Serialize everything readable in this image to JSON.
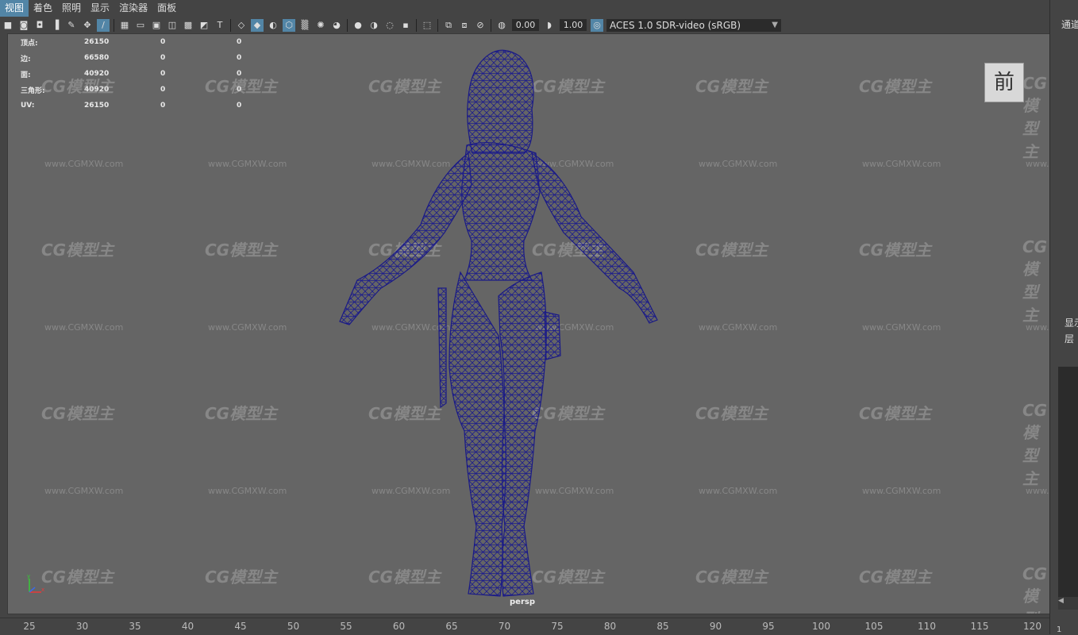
{
  "menu": {
    "items": [
      "视图",
      "着色",
      "照明",
      "显示",
      "渲染器",
      "面板"
    ]
  },
  "toolbar": {
    "exposure": "0.00",
    "gamma": "1.00",
    "color_space": "ACES 1.0 SDR-video (sRGB)"
  },
  "hud": {
    "rows": [
      {
        "label": "顶点:",
        "a": "26150",
        "b": "0",
        "c": "0"
      },
      {
        "label": "边:",
        "a": "66580",
        "b": "0",
        "c": "0"
      },
      {
        "label": "面:",
        "a": "40920",
        "b": "0",
        "c": "0"
      },
      {
        "label": "三角形:",
        "a": "40920",
        "b": "0",
        "c": "0"
      },
      {
        "label": "UV:",
        "a": "26150",
        "b": "0",
        "c": "0"
      }
    ]
  },
  "viewcube": {
    "label": "前"
  },
  "camera": {
    "label": "persp"
  },
  "watermark": {
    "logo": "CG模型主",
    "url": "www.CGMXW.com"
  },
  "ruler": {
    "ticks": [
      "25",
      "30",
      "35",
      "40",
      "45",
      "50",
      "55",
      "60",
      "65",
      "70",
      "75",
      "80",
      "85",
      "90",
      "95",
      "100",
      "105",
      "110",
      "115",
      "120"
    ]
  },
  "right_panel": {
    "channel_tab": "通道",
    "show_label": "显示",
    "layer_label": "层",
    "frame": "1"
  },
  "colors": {
    "viewport_bg": "#656565",
    "wireframe": "#1a1a8a",
    "menu_active": "#5285a6"
  }
}
